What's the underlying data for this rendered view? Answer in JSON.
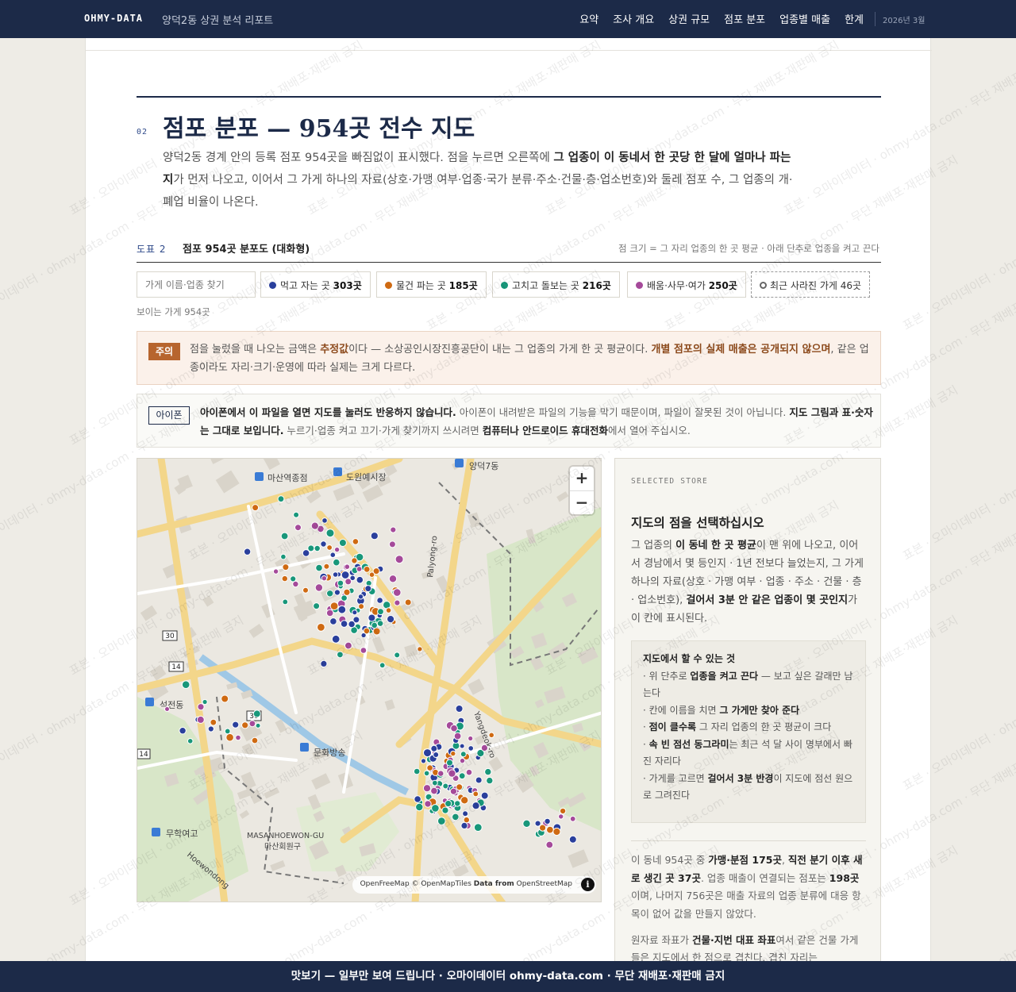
{
  "nav": {
    "brand": "OHMY-DATA",
    "subtitle": "양덕2동 상권 분석 리포트",
    "items": [
      "요약",
      "조사 개요",
      "상권 규모",
      "점포 분포",
      "업종별 매출",
      "한계"
    ],
    "date": "2026년 3월"
  },
  "section": {
    "number": "02",
    "title": "점포 분포 — 954곳 전수 지도",
    "intro": {
      "p1": "양덕2동 경계 안의 등록 점포 954곳을 빠짐없이 표시했다. 점을 누르면 오른쪽에 ",
      "b1": "그 업종이 이 동네서 한 곳당 한 달에 얼마나 파는지",
      "p2": "가 먼저 나오고, 이어서 그 가게 하나의 자료(상호·가맹 여부·업종·국가 분류·주소·건물·층·업소번호)와 둘레 점포 수, 그 업종의 개·폐업 비율이 나온다."
    }
  },
  "figure": {
    "label": "도표 2",
    "title": "점포 954곳 분포도 (대화형)",
    "note": "점 크기 = 그 자리 업종의 한 곳 평균 · 아래 단추로 업종을 켜고 끈다",
    "search_placeholder": "가게 이름·업종 찾기",
    "chips": [
      {
        "label": "먹고 자는 곳",
        "count": "303곳",
        "color": "#2a3f9c"
      },
      {
        "label": "물건 파는 곳",
        "count": "185곳",
        "color": "#cf6a12"
      },
      {
        "label": "고치고 돌보는 곳",
        "count": "216곳",
        "color": "#18977a"
      },
      {
        "label": "배움·사무·여가",
        "count": "250곳",
        "color": "#a54a9a"
      }
    ],
    "closed_chip": {
      "label": "최근 사라진 가게",
      "count": "46곳"
    },
    "visible_count": "보이는 가게 954곳"
  },
  "alert": {
    "badge": "주의",
    "t1": "점을 눌렀을 때 나오는 금액은 ",
    "b1": "추정값",
    "t2": "이다 — 소상공인시장진흥공단이 내는 그 업종의 가게 한 곳 평균이다. ",
    "b2": "개별 점포의 실제 매출은 공개되지 않으며",
    "t3": ", 같은 업종이라도 자리·크기·운영에 따라 실제는 크게 다르다."
  },
  "notice": {
    "badge": "아이폰",
    "b1": "아이폰에서 이 파일을 열면 지도를 눌러도 반응하지 않습니다.",
    "t1": " 아이폰이 내려받은 파일의 기능을 막기 때문이며, 파일이 잘못된 것이 아닙니다. ",
    "b2": "지도 그림과 표·숫자는 그대로 보입니다.",
    "t2": " 누르기·업종 켜고 끄기·가게 찾기까지 쓰시려면 ",
    "b3": "컴퓨터나 안드로이드 휴대전화",
    "t3": "에서 열어 주십시오."
  },
  "map": {
    "zoom_in": "+",
    "zoom_out": "−",
    "attribution_plain": "OpenFreeMap © OpenMapTiles ",
    "attribution_bold": "Data from",
    "attribution_end": " OpenStreetMap",
    "info_icon": "i",
    "place_labels": [
      "마산역종점",
      "도원예시장",
      "양덕7동",
      "Palyong-ro",
      "석전동",
      "문화방송",
      "무학여고",
      "MASANHOEWON-GU",
      "마산회원구",
      "Yangdeok-ro",
      "Hoewondong"
    ],
    "route_shields": [
      "30",
      "14",
      "30",
      "14"
    ]
  },
  "panel": {
    "kicker": "SELECTED STORE",
    "title": "지도의 점을 선택하십시오",
    "d1": "그 업종의 ",
    "db1": "이 동네 한 곳 평균",
    "d2": "이 맨 위에 나오고, 이어서 경남에서 몇 등인지 · 1년 전보다 늘었는지, 그 가게 하나의 자료(상호 · 가맹 여부 · 업종 · 주소 · 건물 · 층 · 업소번호), ",
    "db2": "걸어서 3분 안 같은 업종이 몇 곳인지",
    "d3": "가 이 칸에 표시된다.",
    "howto_title": "지도에서 할 수 있는 것",
    "howto": [
      {
        "pre": "· 위 단추로 ",
        "b": "업종을 켜고 끈다",
        "post": " — 보고 싶은 갈래만 남는다"
      },
      {
        "pre": "· 칸에 이름을 치면 ",
        "b": "그 가게만 찾아 준다",
        "post": ""
      },
      {
        "pre": "· ",
        "b": "점이 클수록",
        "post": " 그 자리 업종의 한 곳 평균이 크다"
      },
      {
        "pre": "· ",
        "b": "속 빈 점선 동그라미",
        "post": "는 최근 석 달 사이 명부에서 빠진 자리다"
      },
      {
        "pre": "· 가게를 고르면 ",
        "b": "걸어서 3분 반경",
        "post": "이 지도에 점선 원으로 그려진다"
      }
    ],
    "s1": "이 동네 954곳 중 ",
    "sb1": "가맹·분점 175곳",
    "s2": ", ",
    "sb2": "직전 분기 이후 새로 생긴 곳 37곳",
    "s3": ". 업종 매출이 연결되는 점포는 ",
    "sb3": "198곳",
    "s4": "이며, 나머지 756곳은 매출 자료의 업종 분류에 대응 항목이 없어 값을 만들지 않았다.",
    "n1": "원자료 좌표가 ",
    "nb1": "건물·지번 대표 좌표",
    "n2": "여서 같은 건물 가게들은 지도에서 한 점으로 겹친다. 겹친 자리는"
  },
  "footer": {
    "text": "맛보기 — 일부만 보여 드립니다 · 오마이데이터 ohmy-data.com · 무단 재배포·재판매 금지"
  },
  "watermark": {
    "text": "표본 · 오마이데이터 · ohmy-data.com · 무단 재배포·재판매 금지"
  }
}
